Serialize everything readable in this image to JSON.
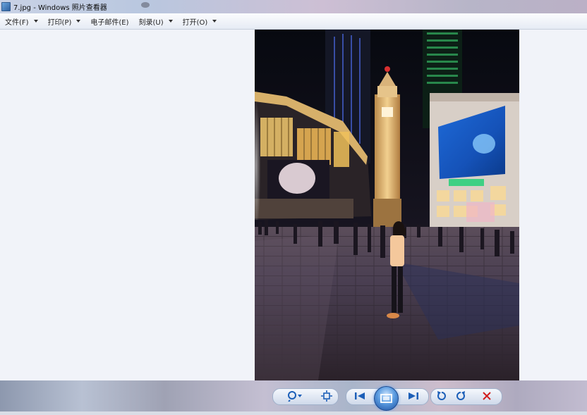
{
  "window": {
    "title": "7.jpg - Windows 照片查看器"
  },
  "menu": {
    "items": [
      {
        "label": "文件(F)",
        "name": "menu-file"
      },
      {
        "label": "打印(P)",
        "name": "menu-print"
      },
      {
        "label": "电子邮件(E)",
        "name": "menu-email"
      },
      {
        "label": "刻录(U)",
        "name": "menu-burn"
      },
      {
        "label": "打开(O)",
        "name": "menu-open"
      }
    ]
  },
  "icons": {
    "zoom": "magnifier-icon",
    "fit": "actual-size-icon",
    "previous": "previous-icon",
    "slideshow": "slideshow-icon",
    "next": "next-icon",
    "rotate_ccw": "rotate-counterclockwise-icon",
    "rotate_cw": "rotate-clockwise-icon",
    "delete": "delete-icon"
  },
  "colors": {
    "accent": "#1c5fb8",
    "delete": "#d21e1e"
  }
}
